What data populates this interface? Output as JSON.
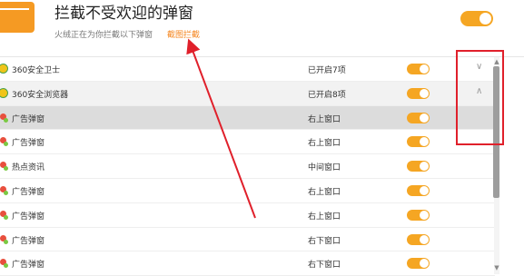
{
  "header": {
    "title": "拦截不受欢迎的弹窗",
    "subtitle": "火绒正在为你拦截以下弹窗",
    "screenshot_link": "截图拦截",
    "master_toggle_on": true
  },
  "groups": [
    {
      "name": "360安全卫士",
      "status": "已开启7项",
      "expanded": false,
      "toggle_on": true
    },
    {
      "name": "360安全浏览器",
      "status": "已开启8项",
      "expanded": true,
      "toggle_on": true
    }
  ],
  "items": [
    {
      "name": "广告弹窗",
      "position": "右上窗口",
      "toggle_on": true
    },
    {
      "name": "广告弹窗",
      "position": "右上窗口",
      "toggle_on": true
    },
    {
      "name": "热点资讯",
      "position": "中间窗口",
      "toggle_on": true
    },
    {
      "name": "广告弹窗",
      "position": "右上窗口",
      "toggle_on": true
    },
    {
      "name": "广告弹窗",
      "position": "右上窗口",
      "toggle_on": true
    },
    {
      "name": "广告弹窗",
      "position": "右下窗口",
      "toggle_on": true
    },
    {
      "name": "广告弹窗",
      "position": "右下窗口",
      "toggle_on": true
    }
  ],
  "icons": {
    "collapse": "chevron-down-icon",
    "expand": "chevron-up-icon"
  },
  "colors": {
    "accent": "#f5a623",
    "link": "#f5861f",
    "annotation": "#e0202b"
  }
}
